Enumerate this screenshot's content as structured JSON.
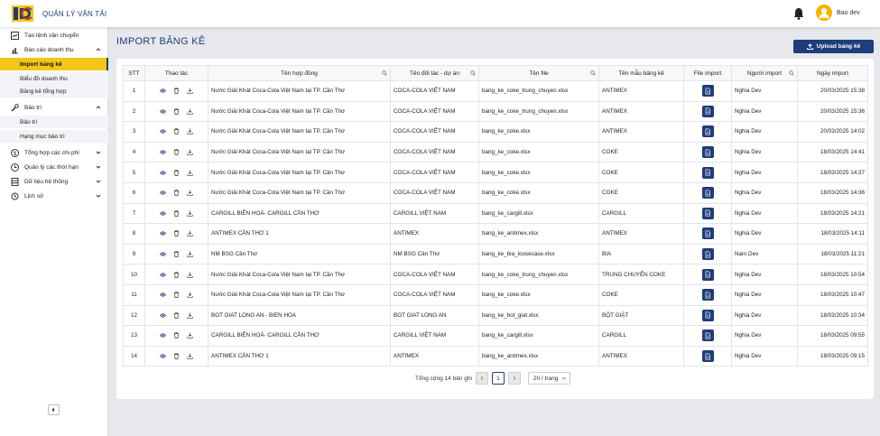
{
  "app": {
    "title": "QUẢN LÝ VẬN TẢI",
    "user": "Bao dev"
  },
  "sidebar": {
    "items": [
      {
        "label": "Tạo lệnh vận chuyển"
      },
      {
        "label": "Báo cáo doanh thu"
      },
      {
        "label": "Bảo trì"
      },
      {
        "label": "Tổng hợp các chi phí"
      },
      {
        "label": "Quản lý các thời hạn"
      },
      {
        "label": "Dữ liệu hệ thống"
      },
      {
        "label": "Lịch sử"
      }
    ],
    "sub_revenue": [
      "Import bảng kê",
      "Biểu đồ doanh thu",
      "Bảng kê tổng hợp"
    ],
    "sub_maint": [
      "Bảo trì",
      "Hạng mục bảo trì"
    ]
  },
  "page": {
    "title": "IMPORT BẢNG KÊ",
    "upload_label": "Upload bảng kê"
  },
  "table": {
    "headers": [
      "STT",
      "Thao tác",
      "Tên hợp đồng",
      "Tên đối tác - dự án",
      "Tên file",
      "Tên mẫu bảng kê",
      "File import",
      "Người import",
      "Ngày import"
    ],
    "rows": [
      [
        "1",
        "Nước Giải Khát Coca-Cola Việt Nam tại TP. Cần Thơ",
        "COCA-COLA VIỆT NAM",
        "bang_ke_coke_trung_chuyen.xlsx",
        "ANTIMEX",
        "Nghia Dev",
        "20/03/2025 15:38"
      ],
      [
        "2",
        "Nước Giải Khát Coca-Cola Việt Nam tại TP. Cần Thơ",
        "COCA-COLA VIỆT NAM",
        "bang_ke_coke_trung_chuyen.xlsx",
        "ANTIMEX",
        "Nghia Dev",
        "20/03/2025 15:36"
      ],
      [
        "3",
        "Nước Giải Khát Coca-Cola Việt Nam tại TP. Cần Thơ",
        "COCA-COLA VIỆT NAM",
        "bang_ke_coke.xlsx",
        "ANTIMEX",
        "Nghia Dev",
        "20/03/2025 14:02"
      ],
      [
        "4",
        "Nước Giải Khát Coca-Cola Việt Nam tại TP. Cần Thơ",
        "COCA-COLA VIỆT NAM",
        "bang_ke_coke.xlsx",
        "COKE",
        "Nghia Dev",
        "18/03/2025 14:41"
      ],
      [
        "5",
        "Nước Giải Khát Coca-Cola Việt Nam tại TP. Cần Thơ",
        "COCA-COLA VIỆT NAM",
        "bang_ke_coke.xlsx",
        "COKE",
        "Nghia Dev",
        "18/03/2025 14:37"
      ],
      [
        "6",
        "Nước Giải Khát Coca-Cola Việt Nam tại TP. Cần Thơ",
        "COCA-COLA VIỆT NAM",
        "bang_ke_coke.xlsx",
        "COKE",
        "Nghia Dev",
        "18/03/2025 14:36"
      ],
      [
        "7",
        "CARGILL BIÊN HOÀ- CARGILL CẦN THƠ",
        "CARGILL VIỆT NAM",
        "bang_ke_cargill.xlsx",
        "CARGILL",
        "Nghia Dev",
        "18/03/2025 14:21"
      ],
      [
        "8",
        "ANTIMEX CẦN THƠ 1",
        "ANTIMEX",
        "bang_ke_antimex.xlsx",
        "ANTIMEX",
        "Nghia Dev",
        "18/03/2025 14:11"
      ],
      [
        "9",
        "NM BSG Cần Thơ",
        "NM BSG Cần Thơ",
        "bang_ke_bia_loosecase.xlsx",
        "BIA",
        "Nam Dev",
        "18/03/2025 11:21"
      ],
      [
        "10",
        "Nước Giải Khát Coca-Cola Việt Nam tại TP. Cần Thơ",
        "COCA-COLA VIỆT NAM",
        "bang_ke_coke_trung_chuyen.xlsx",
        "TRUNG CHUYỂN COKE",
        "Nghia Dev",
        "18/03/2025 10:54"
      ],
      [
        "11",
        "Nước Giải Khát Coca-Cola Việt Nam tại TP. Cần Thơ",
        "COCA-COLA VIỆT NAM",
        "bang_ke_coke.xlsx",
        "COKE",
        "Nghia Dev",
        "18/03/2025 10:47"
      ],
      [
        "12",
        "BOT GIAT LONG AN - BIEN HOA",
        "BOT GIAT LONG AN",
        "bang_ke_bot_giat.xlsx",
        "BỘT GIẶT",
        "Nghia Dev",
        "18/03/2025 10:34"
      ],
      [
        "13",
        "CARGILL BIÊN HOÀ- CARGILL CẦN THƠ",
        "CARGILL VIỆT NAM",
        "bang_ke_cargill.xlsx",
        "CARGILL",
        "Nghia Dev",
        "18/03/2025 09:55"
      ],
      [
        "14",
        "ANTIMEX CẦN THƠ 1",
        "ANTIMEX",
        "bang_ke_antimex.xlsx",
        "ANTIMEX",
        "Nghia Dev",
        "18/03/2025 09:15"
      ]
    ]
  },
  "pagination": {
    "total_label": "Tổng cộng 14 bản ghi",
    "current_page": "1",
    "page_size": "20 / trang"
  },
  "colors": {
    "primary": "#1f3d7a",
    "active": "#f5c518",
    "avatar": "#f5b400"
  }
}
